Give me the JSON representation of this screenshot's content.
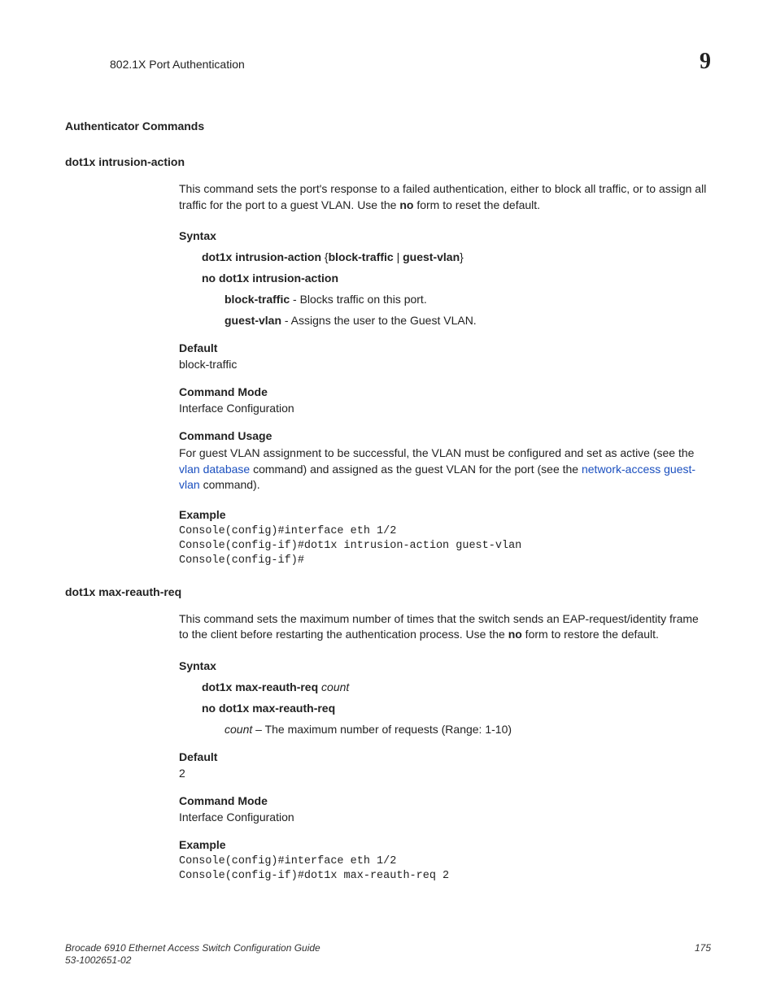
{
  "header": {
    "title": "802.1X Port Authentication",
    "chapter": "9"
  },
  "section_title": "Authenticator Commands",
  "cmd1": {
    "title": "dot1x intrusion-action",
    "desc_pre": "This command sets the port's response to a failed authentication, either to block all traffic, or to assign all traffic for the port to a guest VLAN. Use the ",
    "desc_bold": "no",
    "desc_post": " form to reset the default.",
    "syntax_label": "Syntax",
    "syntax_line1_a": "dot1x intrusion-action",
    "syntax_line1_b": " {",
    "syntax_line1_c": "block-traffic",
    "syntax_line1_d": " | ",
    "syntax_line1_e": "guest-vlan",
    "syntax_line1_f": "}",
    "syntax_line2": "no dot1x intrusion-action",
    "opt1_b": "block-traffic",
    "opt1_t": " - Blocks traffic on this port.",
    "opt2_b": "guest-vlan",
    "opt2_t": " - Assigns the user to the Guest VLAN.",
    "default_label": "Default",
    "default_value": "block-traffic",
    "mode_label": "Command Mode",
    "mode_value": "Interface Configuration",
    "usage_label": "Command Usage",
    "usage_pre": "For guest VLAN assignment to be successful, the VLAN must be configured and set as active (see the ",
    "usage_link1": "vlan database",
    "usage_mid": " command) and assigned as the guest VLAN for the port (see the ",
    "usage_link2": "network-access guest-vlan",
    "usage_post": " command).",
    "example_label": "Example",
    "example_code": "Console(config)#interface eth 1/2\nConsole(config-if)#dot1x intrusion-action guest-vlan\nConsole(config-if)#"
  },
  "cmd2": {
    "title": "dot1x max-reauth-req",
    "desc_pre": "This command sets the maximum number of times that the switch sends an EAP-request/identity frame to the client before restarting the authentication process. Use the ",
    "desc_bold": "no",
    "desc_post": " form to restore the default.",
    "syntax_label": "Syntax",
    "syntax_line1_b": "dot1x max-reauth-req ",
    "syntax_line1_i": "count",
    "syntax_line2": "no dot1x max-reauth-req",
    "arg_i": "count",
    "arg_t": " – The maximum number of requests (Range: 1-10)",
    "default_label": "Default",
    "default_value": "2",
    "mode_label": "Command Mode",
    "mode_value": "Interface Configuration",
    "example_label": "Example",
    "example_code": "Console(config)#interface eth 1/2\nConsole(config-if)#dot1x max-reauth-req 2"
  },
  "footer": {
    "line1": "Brocade 6910 Ethernet Access Switch Configuration Guide",
    "line2": "53-1002651-02",
    "page": "175"
  }
}
